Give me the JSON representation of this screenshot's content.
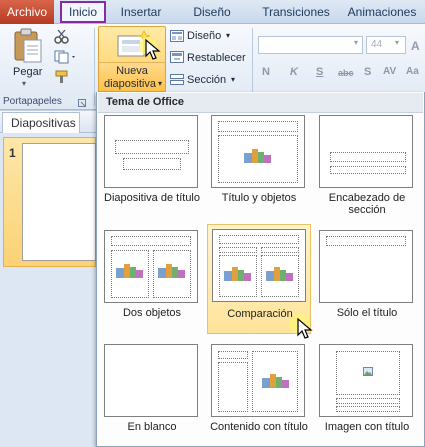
{
  "tabs": {
    "file": "Archivo",
    "home": "Inicio",
    "insert": "Insertar",
    "design": "Diseño",
    "transitions": "Transiciones",
    "animations": "Animaciones"
  },
  "ribbon": {
    "paste": "Pegar",
    "clipboard_group": "Portapapeles",
    "new_slide_line1": "Nueva",
    "new_slide_line2": "diapositiva",
    "layout": "Diseño",
    "reset": "Restablecer",
    "section": "Sección",
    "font_size": "44",
    "fmt_italic": "K",
    "fmt_underline": "S",
    "fmt_strike": "abc",
    "fmt_shadow": "S",
    "fmt_spacing": "AV",
    "fmt_case": "Aa"
  },
  "panel": {
    "slides_tab": "Diapositivas",
    "slide_number": "1"
  },
  "gallery": {
    "header": "Tema de Office",
    "layouts": [
      {
        "label": "Diapositiva de título"
      },
      {
        "label": "Título y objetos"
      },
      {
        "label": "Encabezado de sección"
      },
      {
        "label": "Dos objetos"
      },
      {
        "label": "Comparación"
      },
      {
        "label": "Sólo el título"
      },
      {
        "label": "En blanco"
      },
      {
        "label": "Contenido con título"
      },
      {
        "label": "Imagen con título"
      }
    ],
    "selected_index": 4
  },
  "colors": {
    "file_tab": "#c8492f",
    "active_tab_outline": "#8a2aa0",
    "highlight": "#ffe39a"
  }
}
